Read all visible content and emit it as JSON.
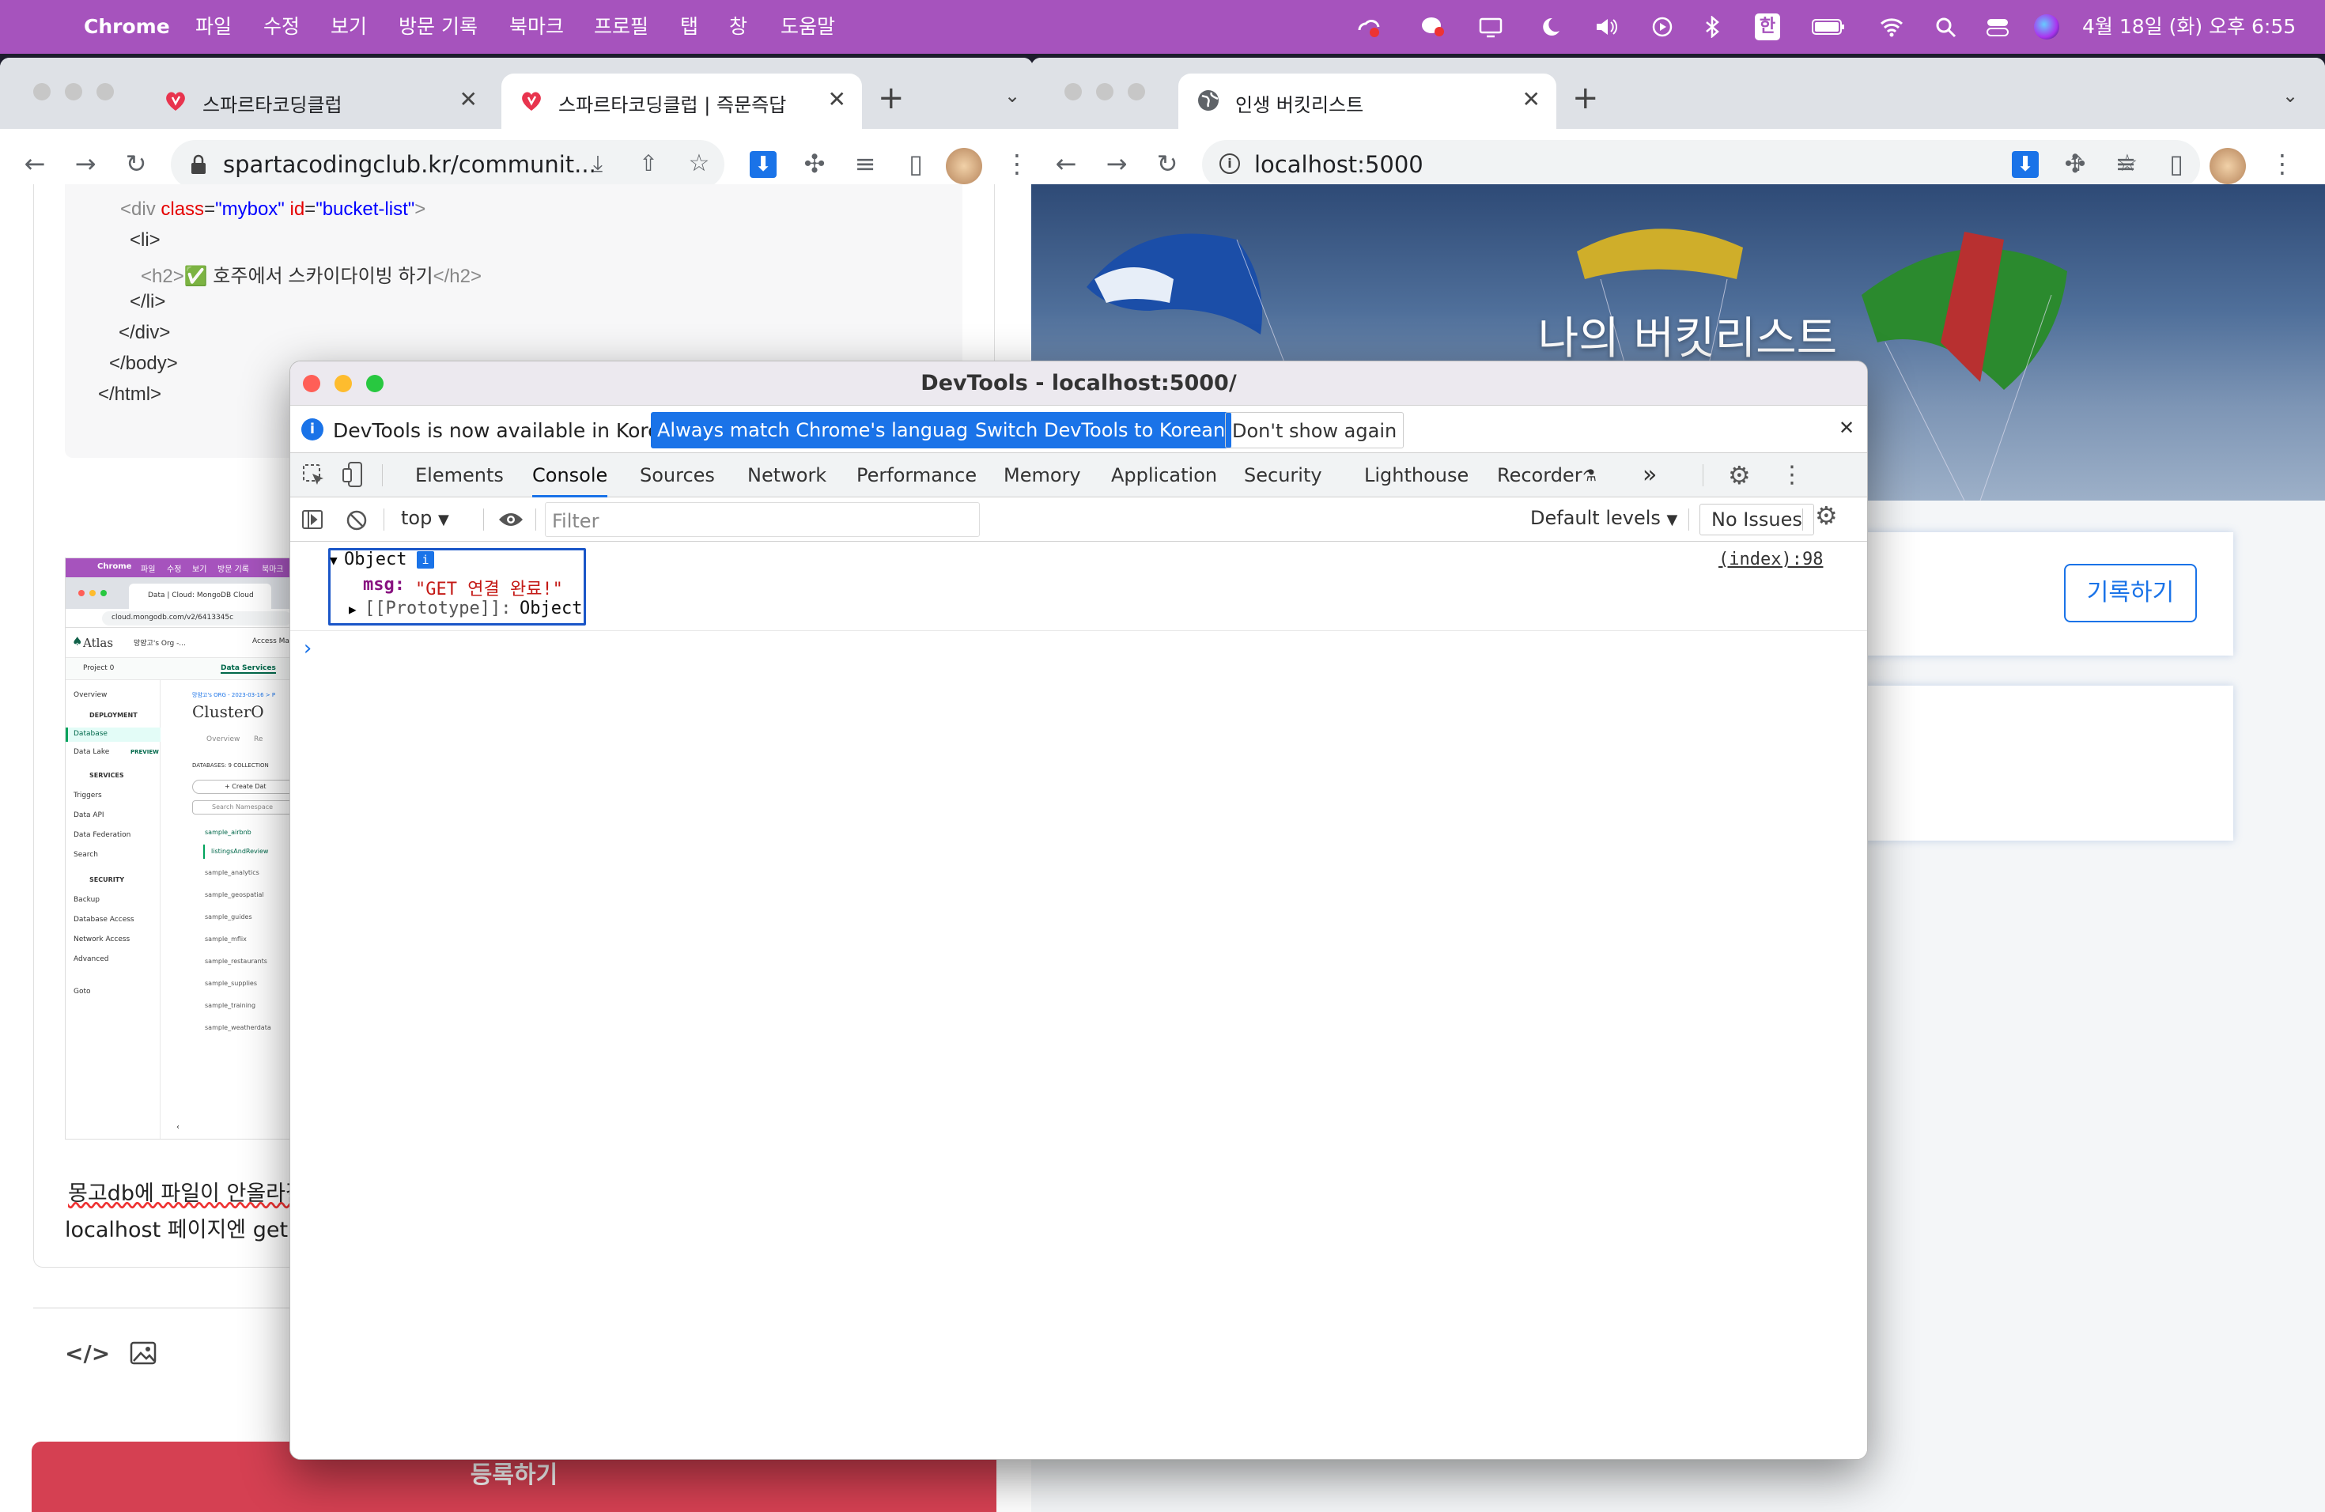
{
  "menubar": {
    "app": "Chrome",
    "items": [
      "파일",
      "수정",
      "보기",
      "방문 기록",
      "북마크",
      "프로필",
      "탭",
      "창",
      "도움말"
    ],
    "ime": "한",
    "datetime": "4월 18일 (화) 오후 6:55"
  },
  "left_window": {
    "tabs": [
      {
        "title": "스파르타코딩클럽"
      },
      {
        "title": "스파르타코딩클럽 | 즉문즉답"
      }
    ],
    "url": "spartacodingclub.kr/communit...",
    "code_lines": {
      "l1_open": "<div ",
      "l1_attr1": "class",
      "l1_val1": "\"mybox\"",
      "l1_attr2": " id",
      "l1_val2": "\"bucket-list\"",
      "l1_close": ">",
      "l2": "<li>",
      "l3_open": "<h2>",
      "l3_text": "✅ 호주에서 스카이다이빙 하기",
      "l3_close": "</h2>",
      "l4": "</li>",
      "l5": "</div>",
      "l6": "</body>",
      "l7": "</html>"
    },
    "shot": {
      "menubar_items": [
        "Chrome",
        "파일",
        "수정",
        "보기",
        "방문 기록",
        "북마크"
      ],
      "tab_title": "Data | Cloud: MongoDB Cloud",
      "url": "cloud.mongodb.com/v2/6413345c",
      "org": "망얌고's Org -...",
      "access": "Access Ma",
      "project": "Project 0",
      "data_services": "Data Services",
      "brand": "Atlas",
      "breadcrumb": "망얌고's ORG - 2023-03-16 > P",
      "cluster": "ClusterO",
      "sub_tabs": [
        "Overview",
        "Re"
      ],
      "db_label": "DATABASES: 9   COLLECTION",
      "create_btn": "+ Create Dat",
      "search_ph": "Search Namespace",
      "sidebar": [
        "Overview",
        "DEPLOYMENT",
        "Database",
        "Data Lake",
        "SERVICES",
        "Triggers",
        "Data API",
        "Data Federation",
        "Search",
        "SECURITY",
        "Backup",
        "Database Access",
        "Network Access",
        "Advanced",
        "Goto"
      ],
      "preview": "PREVIEW",
      "dbs": [
        "sample_airbnb",
        "listingsAndReview",
        "sample_analytics",
        "sample_geospatial",
        "sample_guides",
        "sample_mflix",
        "sample_restaurants",
        "sample_supplies",
        "sample_training",
        "sample_weatherdata"
      ]
    },
    "body_text1": "몽고db에 파일이 안올라갈",
    "body_text2": "localhost 페이지엔 get 연",
    "submit": "등록하기"
  },
  "right_window": {
    "tab_title": "인생 버킷리스트",
    "url": "localhost:5000",
    "hero_title": "나의 버킷리스트",
    "record_btn": "기록하기"
  },
  "devtools": {
    "title": "DevTools - localhost:5000/",
    "notice": "DevTools is now available in Korean!",
    "btn_match": "Always match Chrome's language",
    "btn_switch": "Switch DevTools to Korean",
    "btn_dont": "Don't show again",
    "tabs": [
      "Elements",
      "Console",
      "Sources",
      "Network",
      "Performance",
      "Memory",
      "Application",
      "Security",
      "Lighthouse",
      "Recorder"
    ],
    "active_tab": "Console",
    "context": "top",
    "filter_ph": "Filter",
    "levels": "Default levels",
    "issues": "No Issues",
    "log": {
      "label": "Object",
      "key": "msg",
      "value": "\"GET 연결 완료!\"",
      "proto_key": "[[Prototype]]",
      "proto_val": "Object",
      "source": "(index):98"
    },
    "prompt": "›"
  }
}
